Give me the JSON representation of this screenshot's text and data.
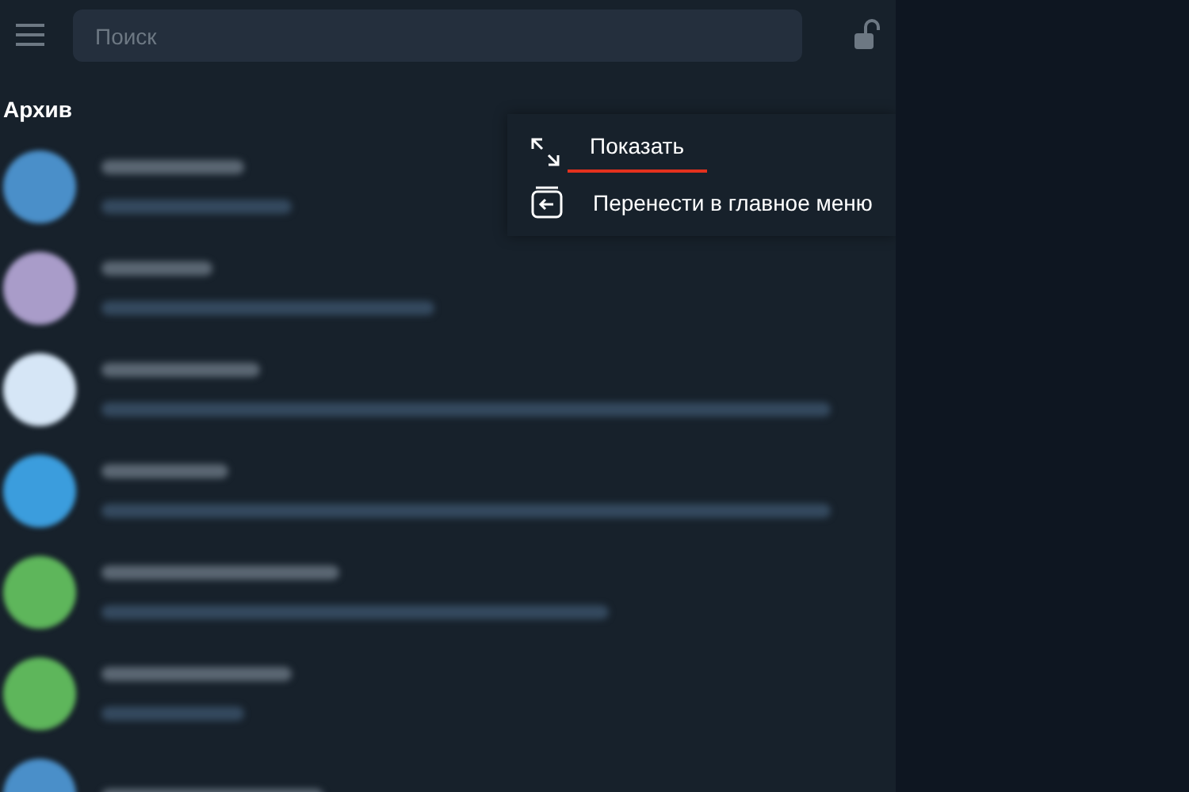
{
  "search": {
    "placeholder": "Поиск"
  },
  "section_title": "Архив",
  "context_menu": [
    {
      "kind": "expand",
      "label": "Показать",
      "underlined": true
    },
    {
      "kind": "move",
      "label": "Перенести в главное меню",
      "underlined": false
    }
  ],
  "chats": [
    {
      "color": "#4a8fc9"
    },
    {
      "color": "#a99cc9"
    },
    {
      "color": "#d6e6f6"
    },
    {
      "color": "#3b9ddd"
    },
    {
      "color": "#5eb65b"
    },
    {
      "color": "#5eb65b"
    },
    {
      "color": "#4a8fc9"
    }
  ]
}
